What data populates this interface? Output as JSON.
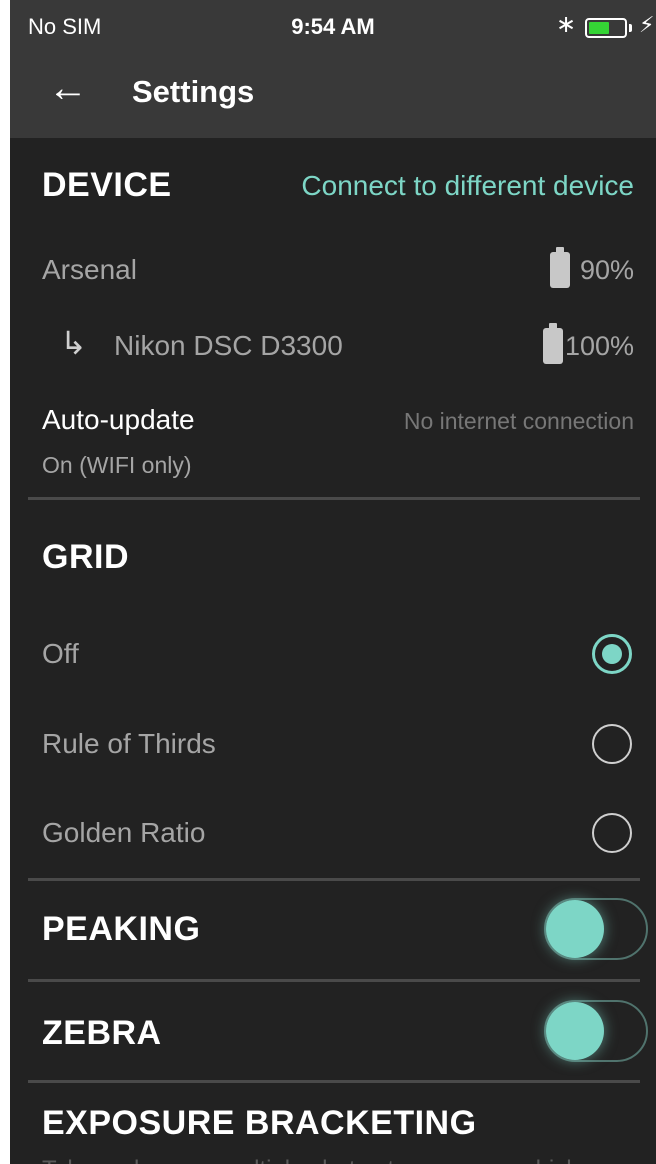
{
  "status_bar": {
    "carrier": "No SIM",
    "time": "9:54 AM",
    "bluetooth_icon": "bluetooth-icon",
    "battery_icon": "battery-icon",
    "charging_icon": "bolt-icon"
  },
  "app_bar": {
    "back_icon": "arrow-left-icon",
    "title": "Settings"
  },
  "device": {
    "title": "DEVICE",
    "connect_label": "Connect to different device",
    "primary_name": "Arsenal",
    "primary_battery": "90%",
    "camera_name": "Nikon DSC D3300",
    "camera_battery": "100%",
    "auto_update_label": "Auto-update",
    "auto_update_value": "On (WIFI only)",
    "auto_update_status": "No internet connection"
  },
  "grid": {
    "title": "GRID",
    "options": [
      {
        "label": "Off",
        "selected": true
      },
      {
        "label": "Rule of Thirds",
        "selected": false
      },
      {
        "label": "Golden Ratio",
        "selected": false
      }
    ]
  },
  "peaking": {
    "title": "PEAKING",
    "enabled": true
  },
  "zebra": {
    "title": "ZEBRA",
    "enabled": true
  },
  "exposure": {
    "title": "EXPOSURE BRACKETING",
    "description_partial": "Take and merge multiple shots at exposures which determine"
  },
  "colors": {
    "accent": "#7dd6c6",
    "background": "#222222",
    "bar": "#393939"
  }
}
